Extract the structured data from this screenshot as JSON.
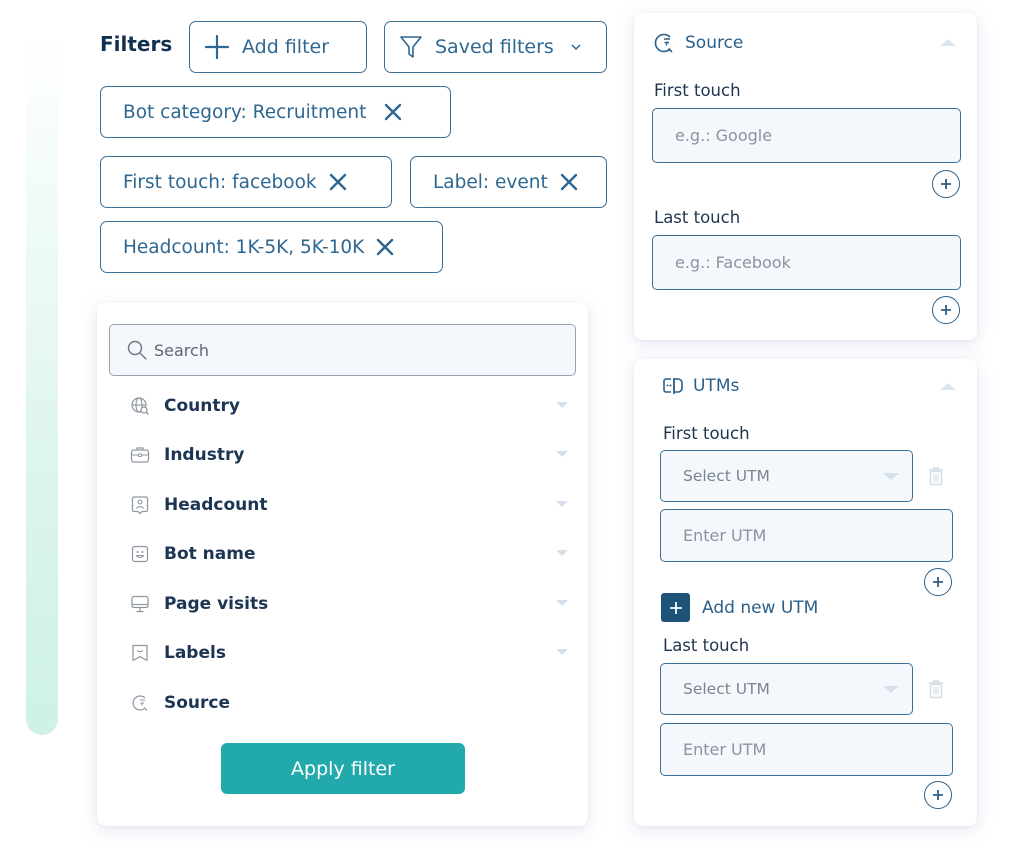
{
  "header": {
    "title": "Filters",
    "add_filter_label": "Add filter",
    "saved_filters_label": "Saved filters"
  },
  "active_filters": [
    {
      "label": "Bot category: Recruitment"
    },
    {
      "label": "First touch: facebook"
    },
    {
      "label": "Label: event"
    },
    {
      "label": "Headcount: 1K-5K, 5K-10K"
    }
  ],
  "filter_panel": {
    "search_placeholder": "Search",
    "items": [
      {
        "label": "Country",
        "icon": "globe-search-icon",
        "expandable": true
      },
      {
        "label": "Industry",
        "icon": "briefcase-icon",
        "expandable": true
      },
      {
        "label": "Headcount",
        "icon": "person-badge-icon",
        "expandable": true
      },
      {
        "label": "Bot name",
        "icon": "bot-face-icon",
        "expandable": true
      },
      {
        "label": "Page visits",
        "icon": "monitor-icon",
        "expandable": true
      },
      {
        "label": "Labels",
        "icon": "label-icon",
        "expandable": true
      },
      {
        "label": "Source",
        "icon": "source-icon",
        "expandable": false
      }
    ],
    "apply_label": "Apply filter"
  },
  "source_card": {
    "title": "Source",
    "first_touch_label": "First touch",
    "first_touch_placeholder": "e.g.: Google",
    "last_touch_label": "Last touch",
    "last_touch_placeholder": "e.g.: Facebook"
  },
  "utm_card": {
    "title": "UTMs",
    "first_touch_label": "First touch",
    "select_placeholder": "Select UTM",
    "enter_placeholder": "Enter UTM",
    "add_new_label": "Add new UTM",
    "last_touch_label": "Last touch"
  },
  "colors": {
    "accent": "#22a9ac",
    "primary_text": "#2e6791",
    "border": "#3c6f96",
    "dark_button": "#1e5378"
  }
}
